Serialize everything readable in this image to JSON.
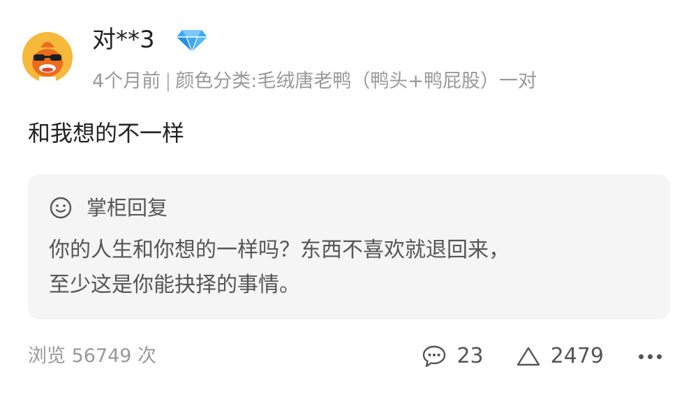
{
  "comment": {
    "username": "对**3",
    "meta": {
      "time": "4个月前",
      "separator": "|",
      "variant": "颜色分类:毛绒唐老鸭（鸭头+鸭屁股）一对"
    },
    "text": "和我想的不一样"
  },
  "reply": {
    "title": "掌柜回复",
    "lines": [
      "你的人生和你想的一样吗？东西不喜欢就退回来，",
      "至少这是你能抉择的事情。"
    ]
  },
  "footer": {
    "views": "浏览 56749 次",
    "comment_count": "23",
    "like_count": "2479"
  },
  "icons": {
    "avatar": "cartoon-duck-avatar-icon",
    "badge": "diamond-icon",
    "reply": "smile-face-icon",
    "comment": "chat-bubble-icon",
    "like": "triangle-up-icon",
    "more": "more-dots-icon"
  },
  "colors": {
    "badge": "#3da9f5",
    "avatar_bg": "#f6b93b",
    "reply_bg": "#f5f5f5"
  }
}
